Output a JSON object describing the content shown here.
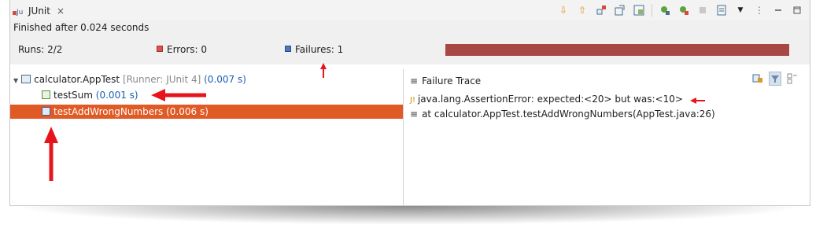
{
  "tab": {
    "title": "JUnit",
    "close": "×"
  },
  "toolbar": {
    "icons": [
      "next-failure-icon",
      "previous-failure-icon",
      "failures-only-icon",
      "scroll-lock-icon",
      "show-skipped-icon",
      "rerun-icon",
      "rerun-failed-first-icon",
      "stop-icon",
      "history-icon",
      "view-menu-icon",
      "more-icon",
      "minimize-icon",
      "maximize-icon"
    ]
  },
  "status": {
    "text": "Finished after 0.024 seconds"
  },
  "counters": {
    "runs": "Runs: 2/2",
    "errors": "Errors: 0",
    "failures": "Failures: 1"
  },
  "progress": {
    "color": "#a84844",
    "fraction": 1.0
  },
  "tree": {
    "suite": {
      "name": "calculator.AppTest",
      "runner": "[Runner: JUnit 4]",
      "time": "(0.007 s)"
    },
    "tests": [
      {
        "name": "testSum",
        "time": "(0.001 s)",
        "status": "passed"
      },
      {
        "name": "testAddWrongNumbers",
        "time": "(0.006 s)",
        "status": "failed",
        "selected": true
      }
    ]
  },
  "trace": {
    "header": "Failure Trace",
    "lines": [
      "java.lang.AssertionError: expected:<20> but was:<10>",
      "at calculator.AppTest.testAddWrongNumbers(AppTest.java:26)"
    ]
  },
  "colors": {
    "selection": "#e05a25",
    "arrow": "#e8141b",
    "failure_bar": "#a84844"
  }
}
